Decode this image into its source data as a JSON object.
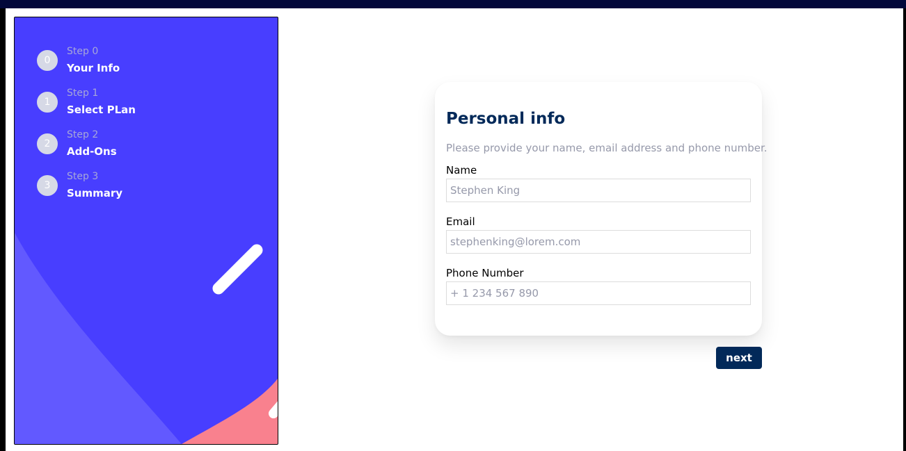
{
  "sidebar": {
    "steps": [
      {
        "number": "0",
        "step_label": "Step 0",
        "title": "Your Info"
      },
      {
        "number": "1",
        "step_label": "Step 1",
        "title": "Select PLan"
      },
      {
        "number": "2",
        "step_label": "Step 2",
        "title": "Add-Ons"
      },
      {
        "number": "3",
        "step_label": "Step 3",
        "title": "Summary"
      }
    ]
  },
  "form": {
    "title": "Personal info",
    "description": "Please provide your name, email address and phone number.",
    "fields": {
      "name": {
        "label": "Name",
        "placeholder": "Stephen King"
      },
      "email": {
        "label": "Email",
        "placeholder": "stephenking@lorem.com"
      },
      "phone": {
        "label": "Phone Number",
        "placeholder": "+ 1 234 567 890"
      }
    }
  },
  "actions": {
    "next_label": "next"
  },
  "colors": {
    "sidebar_bg": "#483eff",
    "sidebar_curve": "#6259ff",
    "sidebar_coral": "#f9818e",
    "title": "#022959",
    "muted": "#9699aa",
    "button_bg": "#022959"
  }
}
